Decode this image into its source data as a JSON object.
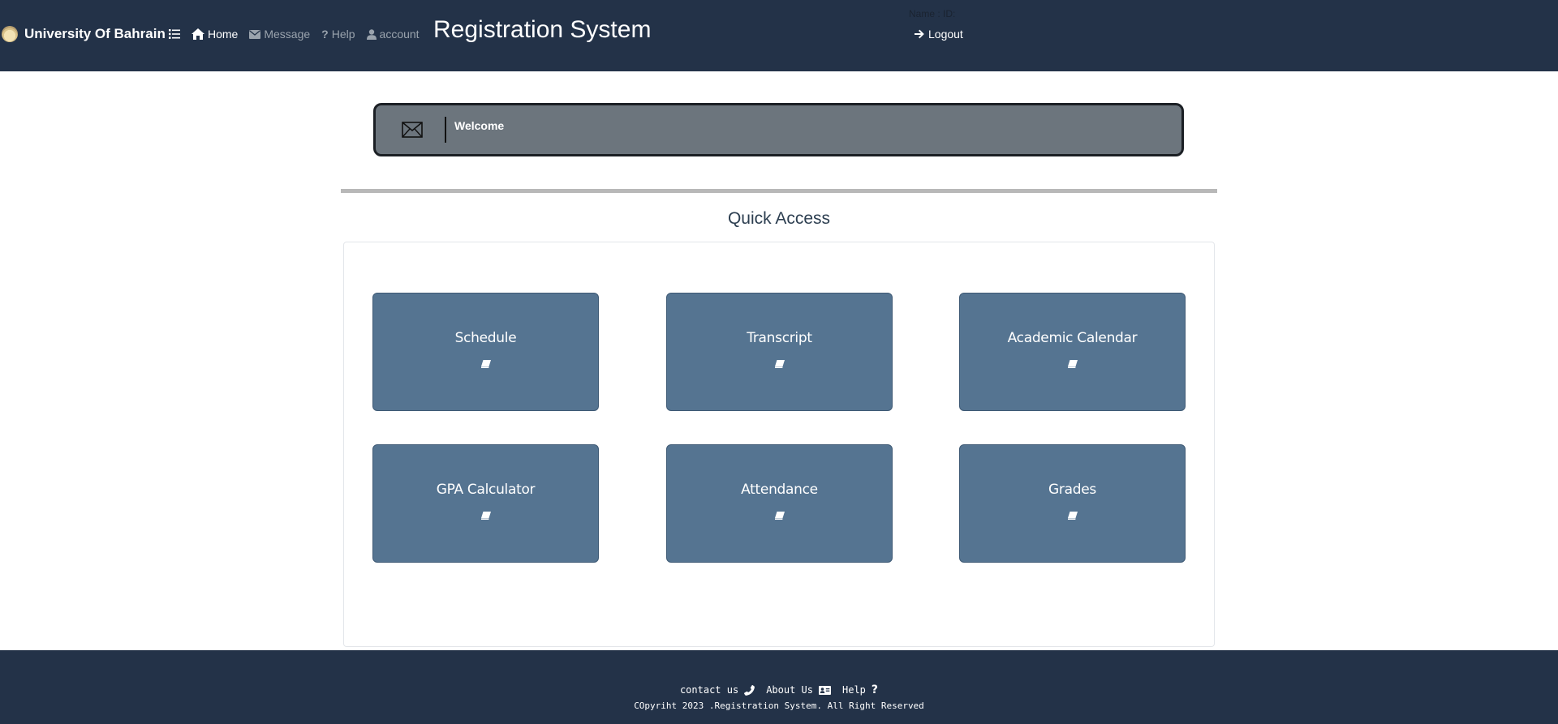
{
  "header": {
    "brand_name": "University Of Bahrain",
    "nav": [
      {
        "label": "Home",
        "icon": "home-icon"
      },
      {
        "label": "Message",
        "icon": "envelope-icon"
      },
      {
        "label": "Help",
        "icon": "question-icon"
      },
      {
        "label": "account",
        "icon": "user-icon"
      }
    ],
    "menu_icon": "list-icon",
    "title": "Registration System",
    "name_id": "Name : ID:",
    "logout_label": "Logout"
  },
  "welcome": {
    "text": "Welcome",
    "icon": "envelope-icon"
  },
  "quick_access": {
    "title": "Quick Access",
    "cards": [
      {
        "label": "Schedule",
        "icon": "book-icon"
      },
      {
        "label": "Transcript",
        "icon": "book-icon"
      },
      {
        "label": "Academic Calendar",
        "icon": "book-icon"
      },
      {
        "label": "GPA Calculator",
        "icon": "book-icon"
      },
      {
        "label": "Attendance",
        "icon": "book-icon"
      },
      {
        "label": "Grades",
        "icon": "book-icon"
      }
    ]
  },
  "footer": {
    "links": [
      {
        "label": "contact us",
        "icon": "phone-icon"
      },
      {
        "label": "About Us",
        "icon": "id-card-icon"
      },
      {
        "label": "Help",
        "icon": "question-icon"
      }
    ],
    "copyright": "COpyriht 2023 .Registration System. All Right Reserved"
  },
  "colors": {
    "navbar": "#233248",
    "card": "#557491",
    "banner": "#6c757d"
  }
}
